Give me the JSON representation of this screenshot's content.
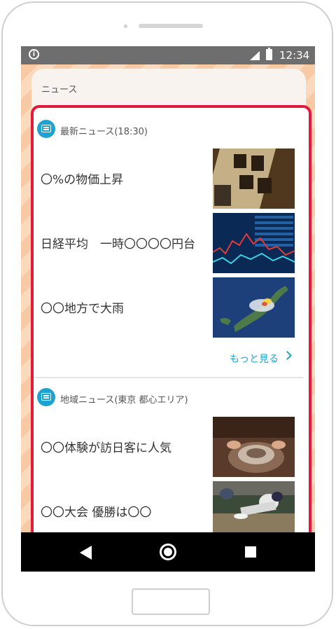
{
  "statusbar": {
    "time": "12:34"
  },
  "header": {
    "title": "ニュース"
  },
  "sections": [
    {
      "label": "最新ニュース(18:30)",
      "items": [
        {
          "title": "〇%の物価上昇"
        },
        {
          "title": "日経平均　一時〇〇〇〇円台"
        },
        {
          "title": "〇〇地方で大雨"
        }
      ],
      "more_label": "もっと見る"
    },
    {
      "label": "地域ニュース(東京 都心エリア)",
      "items": [
        {
          "title": "〇〇体験が訪日客に人気"
        },
        {
          "title": "〇〇大会 優勝は〇〇"
        }
      ]
    }
  ],
  "colors": {
    "accent": "#1ea3d1",
    "highlight_border": "#e5193c",
    "statusbar": "#6e6e6e"
  }
}
